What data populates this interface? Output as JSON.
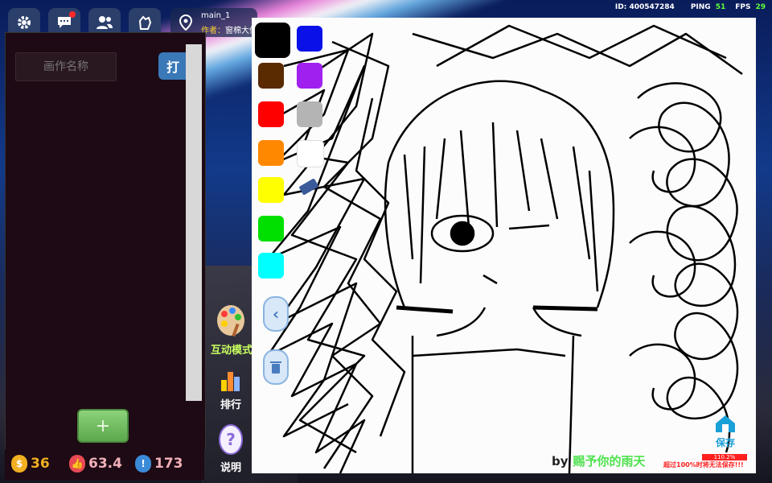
{
  "topbar": {
    "icons": [
      "gear-icon",
      "chat-icon",
      "friends-icon",
      "switch-icon",
      "map-pin-icon"
    ],
    "map_title": "main_1",
    "author_label": "作者：",
    "author_name": "窗棉大仙",
    "id_text": "ID: 400547284",
    "ping_label": "PING",
    "ping_value": "51",
    "fps_label": "FPS",
    "fps_value": "29"
  },
  "left_panel": {
    "name_placeholder": "画作名称",
    "confirm_label": "打",
    "add_label": "+"
  },
  "resources": [
    {
      "icon": "coin-icon",
      "value": "36",
      "color": "#f0b020"
    },
    {
      "icon": "thumbs-up-icon",
      "value": "63.4",
      "color": "#e84a55"
    },
    {
      "icon": "exclamation-icon",
      "value": "173",
      "color": "#3a8ad8"
    }
  ],
  "side_menu": {
    "interactive_mode": "互动模式",
    "ranking": "排行",
    "help": "说明"
  },
  "palette": [
    "#000000",
    "#0a10e8",
    "#5a2a00",
    "#a020f0",
    "#ff0000",
    "#b4b4b4",
    "#ff8800",
    "#ffffff",
    "#ffff00",
    "#00e000",
    "#00ffff"
  ],
  "canvas": {
    "signature_by": "by",
    "signature_text": "赐予你的雨天",
    "save_label": "保存",
    "usage_percent": "110.2%",
    "warning": "超过100%时将无法保存!!!"
  }
}
